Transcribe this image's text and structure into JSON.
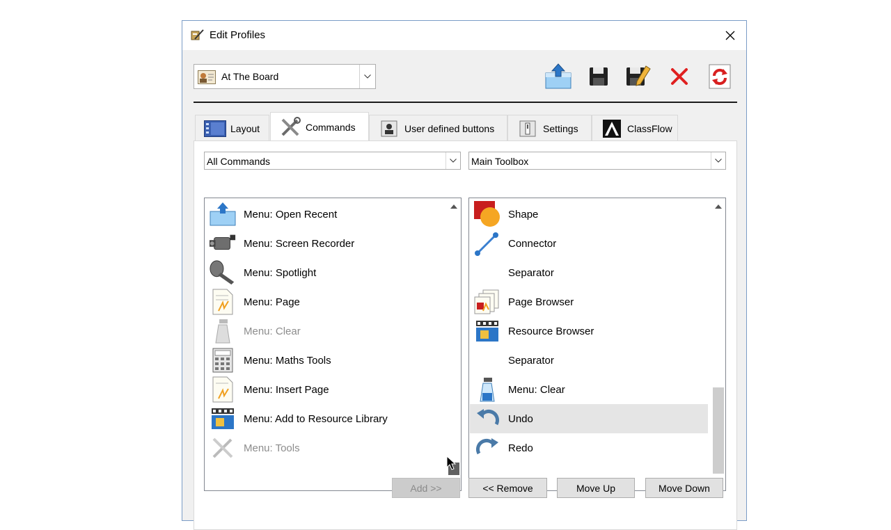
{
  "window": {
    "title": "Edit Profiles"
  },
  "profile": {
    "selected": "At The Board"
  },
  "toolbar": {
    "icons": [
      "export-profile-icon",
      "save-icon",
      "save-as-icon",
      "delete-icon",
      "refresh-icon"
    ]
  },
  "tabs": [
    {
      "label": "Layout",
      "icon": "layout-icon"
    },
    {
      "label": "Commands",
      "icon": "tools-icon",
      "active": true
    },
    {
      "label": "User defined buttons",
      "icon": "user-button-icon"
    },
    {
      "label": "Settings",
      "icon": "settings-icon"
    },
    {
      "label": "ClassFlow",
      "icon": "classflow-icon"
    }
  ],
  "left": {
    "filter": "All Commands",
    "items": [
      {
        "label": "Menu: Open Recent",
        "icon": "open-recent-icon"
      },
      {
        "label": "Menu: Screen Recorder",
        "icon": "camcorder-icon"
      },
      {
        "label": "Menu: Spotlight",
        "icon": "spotlight-icon"
      },
      {
        "label": "Menu: Page",
        "icon": "page-icon"
      },
      {
        "label": "Menu: Clear",
        "icon": "spray-bottle-icon",
        "disabled": true
      },
      {
        "label": "Menu: Maths Tools",
        "icon": "calculator-icon"
      },
      {
        "label": "Menu: Insert Page",
        "icon": "insert-page-icon"
      },
      {
        "label": "Menu: Add to Resource Library",
        "icon": "resource-library-icon"
      },
      {
        "label": "Menu: Tools",
        "icon": "tools-icon",
        "disabled": true
      }
    ]
  },
  "right": {
    "toolbox": "Main Toolbox",
    "items": [
      {
        "label": "Shape",
        "icon": "shape-icon"
      },
      {
        "label": "Connector",
        "icon": "connector-icon"
      },
      {
        "label": "Separator",
        "icon": ""
      },
      {
        "label": "Page Browser",
        "icon": "page-browser-icon"
      },
      {
        "label": "Resource Browser",
        "icon": "resource-browser-icon"
      },
      {
        "label": "Separator",
        "icon": ""
      },
      {
        "label": "Menu: Clear",
        "icon": "spray-bottle-icon"
      },
      {
        "label": "Undo",
        "icon": "undo-icon",
        "selected": true
      },
      {
        "label": "Redo",
        "icon": "redo-icon"
      }
    ]
  },
  "buttons": {
    "add": "Add >>",
    "remove": "<< Remove",
    "move_up": "Move Up",
    "move_down": "Move Down"
  },
  "colors": {
    "delete_red": "#e02020",
    "refresh_red": "#d82020",
    "selection": "#e5e5e5"
  }
}
